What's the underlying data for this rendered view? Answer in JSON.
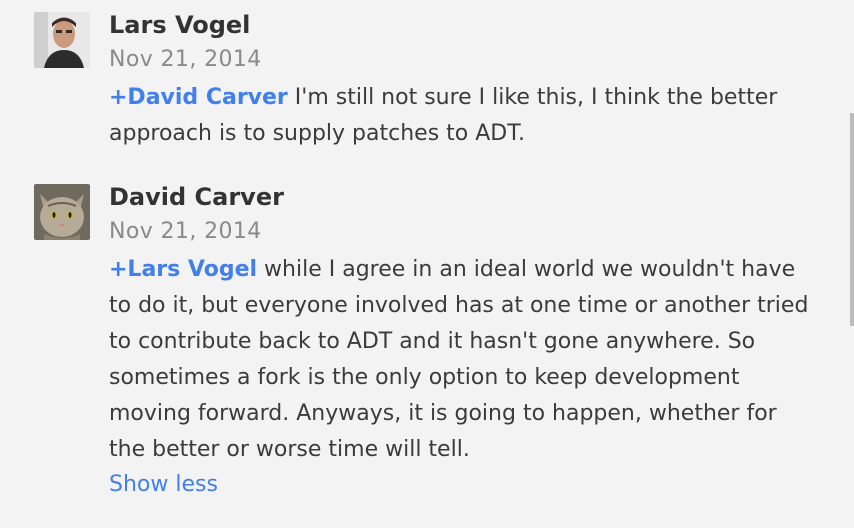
{
  "comments": [
    {
      "author": "Lars Vogel",
      "date": "Nov 21, 2014",
      "mention": "+David Carver",
      "text": " I'm still not sure I like this, I think the better approach is to supply patches to ADT."
    },
    {
      "author": "David Carver",
      "date": "Nov 21, 2014",
      "mention": "+Lars Vogel",
      "text": " while I agree in an ideal world we wouldn't have to do it, but everyone involved has at one time or another tried to contribute back to ADT and it hasn't gone anywhere.  So sometimes a fork is the only option to keep development moving forward.  Anyways, it is going to happen, whether for the better or worse time will tell."
    }
  ],
  "show_less_label": "Show less",
  "colors": {
    "background": "#f3f3f3",
    "mention": "#427fed",
    "date": "#8a8a8a",
    "text": "#3b3b3b"
  }
}
